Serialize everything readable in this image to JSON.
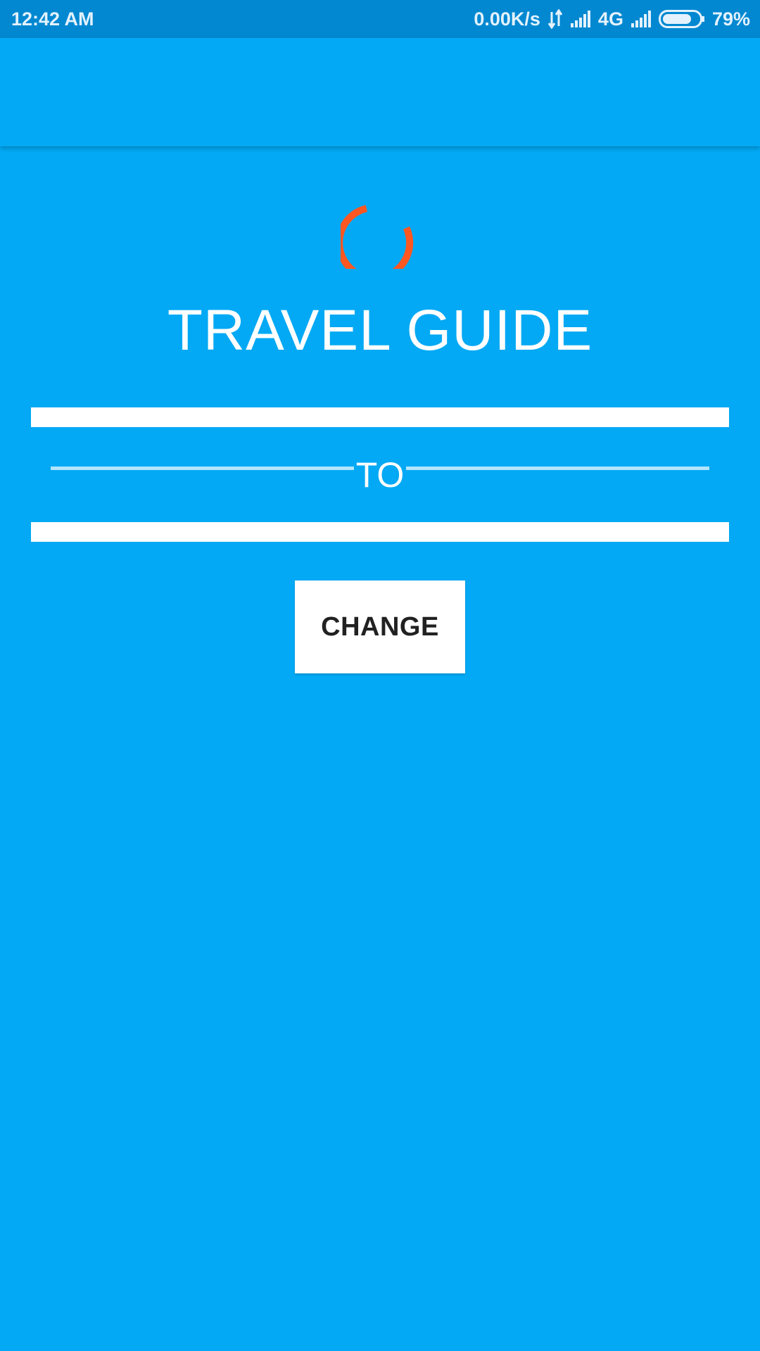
{
  "status_bar": {
    "time": "12:42 AM",
    "network_speed": "0.00K/s",
    "network_type": "4G",
    "battery_percent": "79%",
    "battery_level": 0.79,
    "icons": [
      "data-transfer-icon",
      "signal-icon",
      "signal-icon-2",
      "battery-icon"
    ]
  },
  "app": {
    "title": "TRAVEL GUIDE",
    "separator_label": "TO",
    "change_button_label": "CHANGE",
    "from_field": {
      "value": "",
      "placeholder": ""
    },
    "to_field": {
      "value": "",
      "placeholder": ""
    }
  },
  "colors": {
    "background": "#03A9F4",
    "status_bar": "#0288D1",
    "spinner": "#FF5722",
    "divider": "#B3E5FC",
    "button_bg": "#FFFFFF",
    "button_text": "#212121"
  }
}
